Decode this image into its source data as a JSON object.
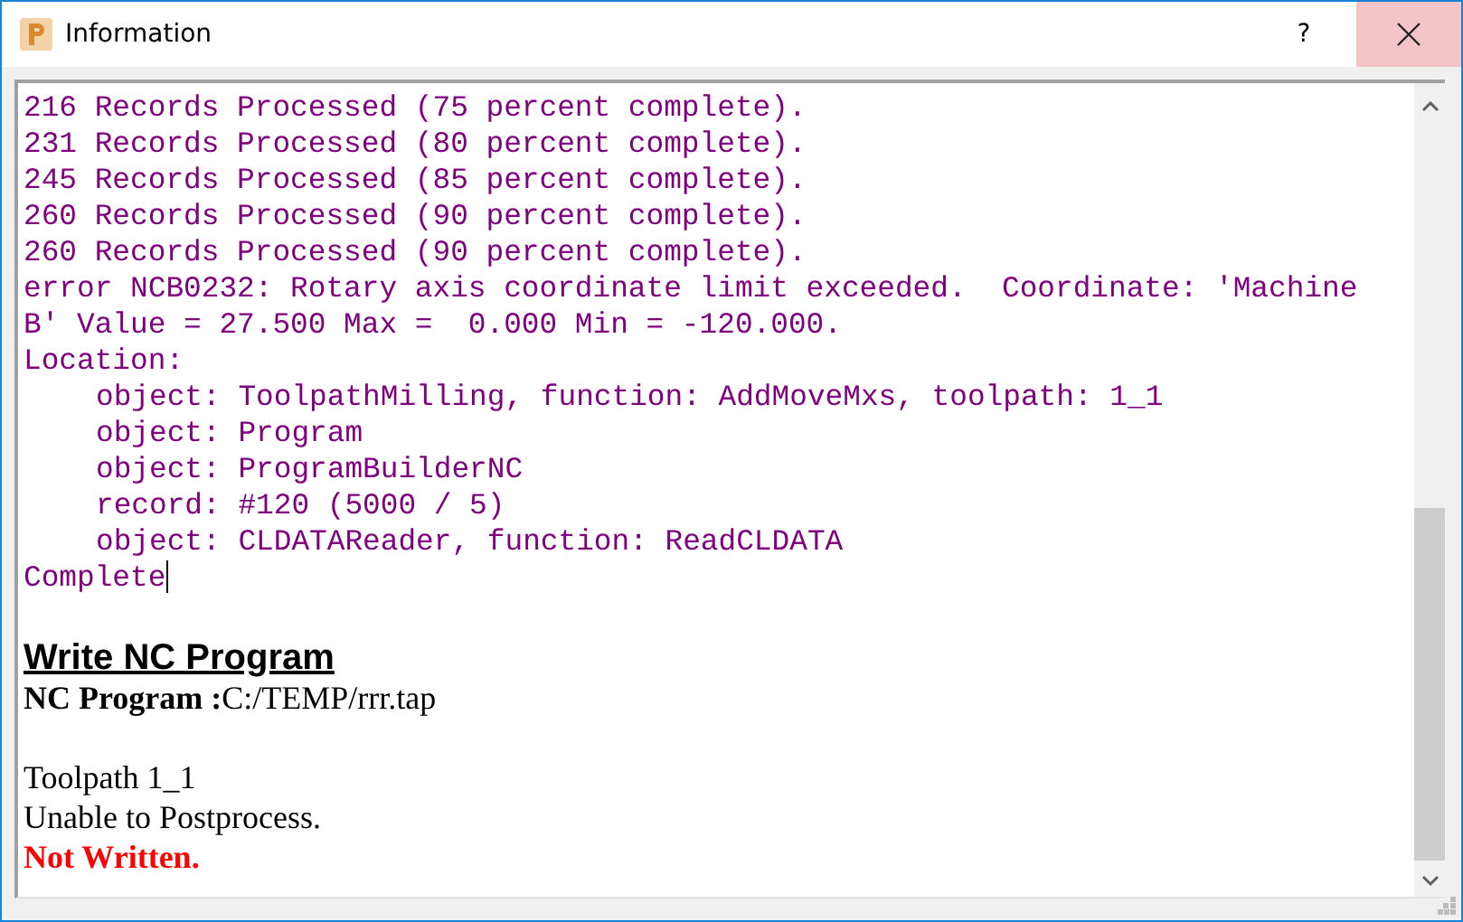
{
  "window": {
    "title": "Information",
    "help": "?"
  },
  "log": [
    {
      "text": "216 Records Processed (75 percent complete)."
    },
    {
      "text": "231 Records Processed (80 percent complete)."
    },
    {
      "text": "245 Records Processed (85 percent complete)."
    },
    {
      "text": "260 Records Processed (90 percent complete)."
    },
    {
      "text": "260 Records Processed (90 percent complete)."
    },
    {
      "text": "error NCB0232: Rotary axis coordinate limit exceeded.  Coordinate: 'Machine"
    },
    {
      "text": "B' Value = 27.500 Max =  0.000 Min = -120.000."
    },
    {
      "text": "Location:",
      "children": [
        {
          "text": "object: ToolpathMilling, function: AddMoveMxs, toolpath: 1_1"
        },
        {
          "text": "object: Program"
        },
        {
          "text": "object: ProgramBuilderNC"
        },
        {
          "text": "record: #120 (5000 / 5)"
        },
        {
          "text": "object: CLDATAReader, function: ReadCLDATA"
        }
      ]
    },
    {
      "text": "Complete"
    }
  ],
  "report": [
    {
      "kind": "heading",
      "text": "Write NC Program"
    },
    {
      "kind": "field",
      "label": "NC Program :",
      "value": "C:/TEMP/rrr.tap"
    },
    {
      "kind": "blank"
    },
    {
      "kind": "text",
      "text": "Toolpath 1_1"
    },
    {
      "kind": "text",
      "text": "Unable to Postprocess."
    },
    {
      "kind": "error",
      "text": "Not Written."
    }
  ]
}
